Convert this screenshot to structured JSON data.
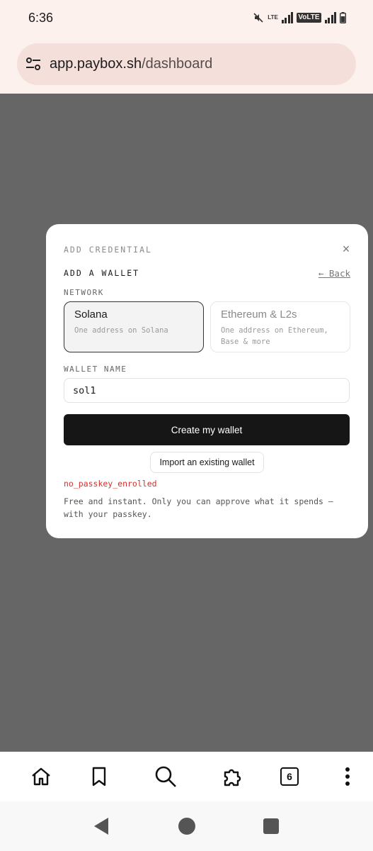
{
  "status_bar": {
    "time": "6:36",
    "lte_label": "LTE",
    "volte_label": "VoLTE",
    "icons": [
      "mute-icon",
      "signal-icon",
      "volte-icon",
      "signal-icon",
      "battery-icon"
    ]
  },
  "browser": {
    "url_domain": "app.paybox.sh",
    "url_path": "/dashboard",
    "site_settings_icon": "tune-icon",
    "tab_count": "6",
    "bottom_icons": [
      "home-icon",
      "bookmark-icon",
      "search-icon",
      "extensions-icon",
      "tabs-icon",
      "more-icon"
    ]
  },
  "modal": {
    "title": "ADD CREDENTIAL",
    "close_glyph": "×",
    "section_title": "ADD A WALLET",
    "back_label": "← Back",
    "network_label": "NETWORK",
    "networks": [
      {
        "name": "Solana",
        "description": "One address on Solana",
        "selected": true
      },
      {
        "name": "Ethereum & L2s",
        "description": "One address on Ethereum, Base & more",
        "selected": false
      }
    ],
    "wallet_name_label": "WALLET NAME",
    "wallet_name_value": "sol1",
    "create_button": "Create my wallet",
    "import_button": "Import an existing wallet",
    "error": "no_passkey_enrolled",
    "info": "Free and instant. Only you can approve what it spends — with your passkey."
  },
  "colors": {
    "overlay": "#666666",
    "chrome_bg": "#fdf1ee",
    "url_pill": "#f4dfdb",
    "primary_button": "#161616",
    "error": "#d0312d"
  }
}
